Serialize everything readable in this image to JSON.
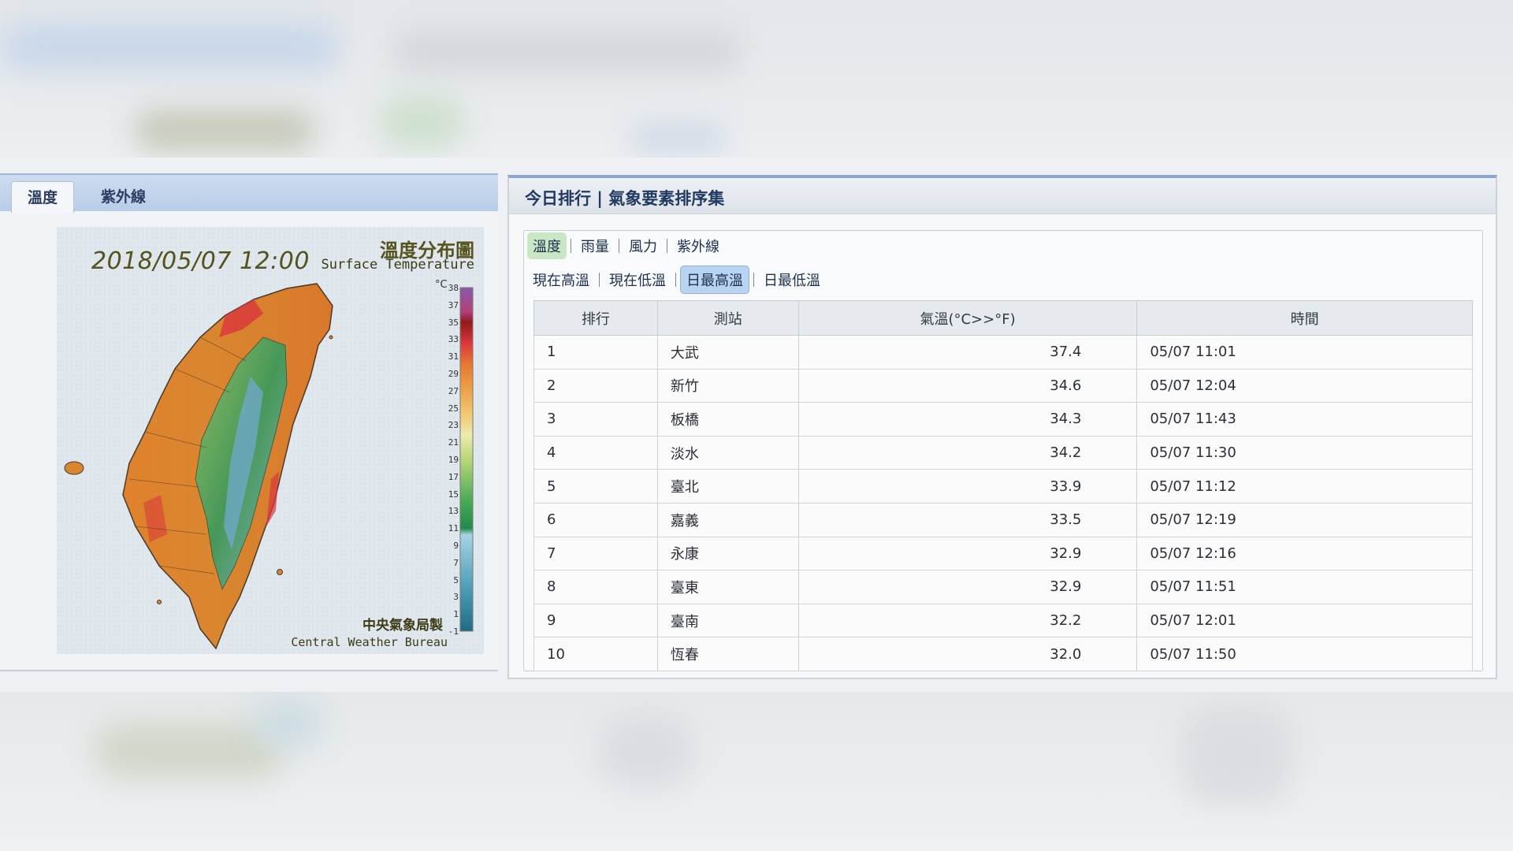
{
  "left": {
    "tabs": [
      {
        "label": "溫度",
        "active": true
      },
      {
        "label": "紫外線",
        "active": false
      }
    ],
    "map": {
      "date_time": "2018/05/07 12:00",
      "title_zh": "溫度分布圖",
      "title_en": "Surface Temperature",
      "unit": "°C",
      "legend_ticks": [
        "38",
        "37",
        "35",
        "33",
        "31",
        "29",
        "27",
        "25",
        "23",
        "21",
        "19",
        "17",
        "15",
        "13",
        "11",
        "9",
        "7",
        "5",
        "3",
        "1",
        "-1"
      ],
      "footer_zh": "中央氣象局製",
      "footer_en": "Central Weather Bureau"
    }
  },
  "right": {
    "title": "今日排行 | 氣象要素排序集",
    "element_tabs": [
      {
        "label": "溫度",
        "active": true
      },
      {
        "label": "雨量",
        "active": false
      },
      {
        "label": "風力",
        "active": false
      },
      {
        "label": "紫外線",
        "active": false
      }
    ],
    "temp_tabs": [
      {
        "label": "現在高溫",
        "active": false
      },
      {
        "label": "現在低溫",
        "active": false
      },
      {
        "label": "日最高溫",
        "active": true
      },
      {
        "label": "日最低溫",
        "active": false
      }
    ],
    "table": {
      "headers": [
        "排行",
        "測站",
        "氣溫(°C>>°F)",
        "時間"
      ],
      "rows": [
        [
          "1",
          "大武",
          "37.4",
          "05/07 11:01"
        ],
        [
          "2",
          "新竹",
          "34.6",
          "05/07 12:04"
        ],
        [
          "3",
          "板橋",
          "34.3",
          "05/07 11:43"
        ],
        [
          "4",
          "淡水",
          "34.2",
          "05/07 11:30"
        ],
        [
          "5",
          "臺北",
          "33.9",
          "05/07 11:12"
        ],
        [
          "6",
          "嘉義",
          "33.5",
          "05/07 12:19"
        ],
        [
          "7",
          "永康",
          "32.9",
          "05/07 12:16"
        ],
        [
          "8",
          "臺東",
          "32.9",
          "05/07 11:51"
        ],
        [
          "9",
          "臺南",
          "32.2",
          "05/07 12:01"
        ],
        [
          "10",
          "恆春",
          "32.0",
          "05/07 11:50"
        ]
      ]
    }
  },
  "colors": {
    "accent_blue": "#b9d3f2",
    "accent_green": "#c9e7c5",
    "header_text": "#213a62"
  }
}
